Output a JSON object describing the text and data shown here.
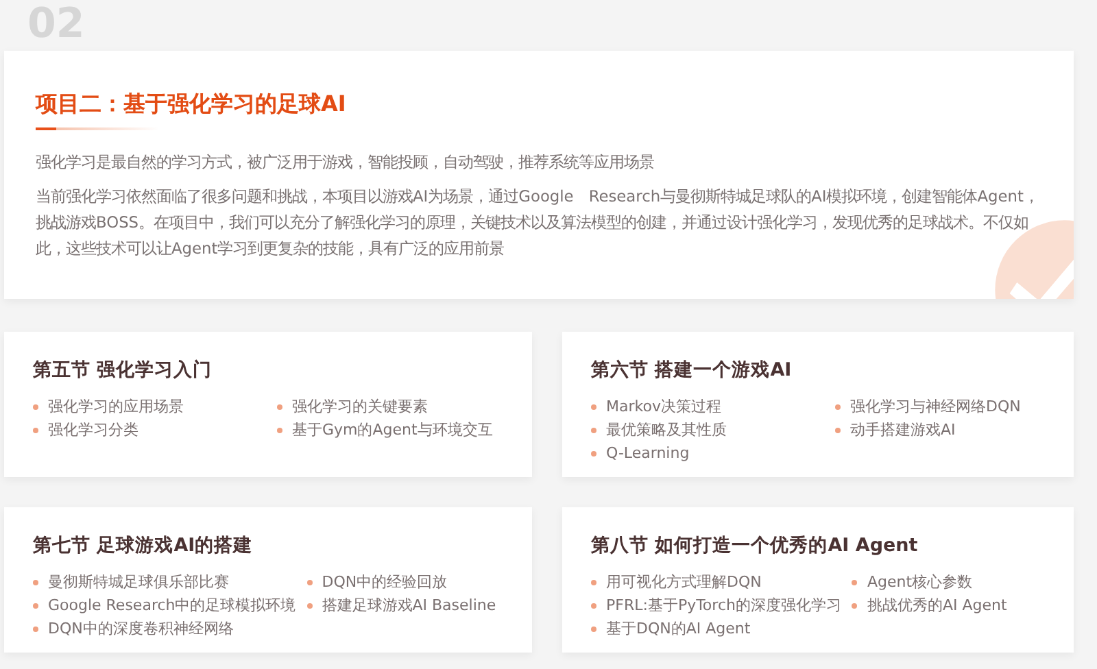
{
  "section_number": "02",
  "project": {
    "title": "项目二：基于强化学习的足球AI",
    "paragraphs": [
      "强化学习是最自然的学习方式，被广泛用于游戏，智能投顾，自动驾驶，推荐系统等应用场景",
      "当前强化学习依然面临了很多问题和挑战，本项目以游戏AI为场景，通过Google　Research与曼彻斯特城足球队的AI模拟环境，创建智能体Agent，挑战游戏BOSS。在项目中，我们可以充分了解强化学习的原理，关键技术以及算法模型的创建，并通过设计强化学习，发现优秀的足球战术。不仅如此，这些技术可以让Agent学习到更复杂的技能，具有广泛的应用前景"
    ]
  },
  "sections": [
    {
      "title": "第五节 强化学习入门",
      "items": [
        "强化学习的应用场景",
        "强化学习的关键要素",
        "强化学习分类",
        "基于Gym的Agent与环境交互"
      ]
    },
    {
      "title": "第六节 搭建一个游戏AI",
      "items": [
        "Markov决策过程",
        "强化学习与神经网络DQN",
        "最优策略及其性质",
        "动手搭建游戏AI",
        "Q-Learning"
      ]
    },
    {
      "title": "第七节 足球游戏AI的搭建",
      "items": [
        "曼彻斯特城足球俱乐部比赛",
        "DQN中的经验回放",
        "Google Research中的足球模拟环境",
        "搭建足球游戏AI Baseline",
        "DQN中的深度卷积神经网络"
      ]
    },
    {
      "title": "第八节 如何打造一个优秀的AI Agent",
      "items": [
        "用可视化方式理解DQN",
        "Agent核心参数",
        "PFRL:基于PyTorch的深度强化学习",
        "挑战优秀的AI Agent",
        "基于DQN的AI Agent"
      ]
    }
  ]
}
